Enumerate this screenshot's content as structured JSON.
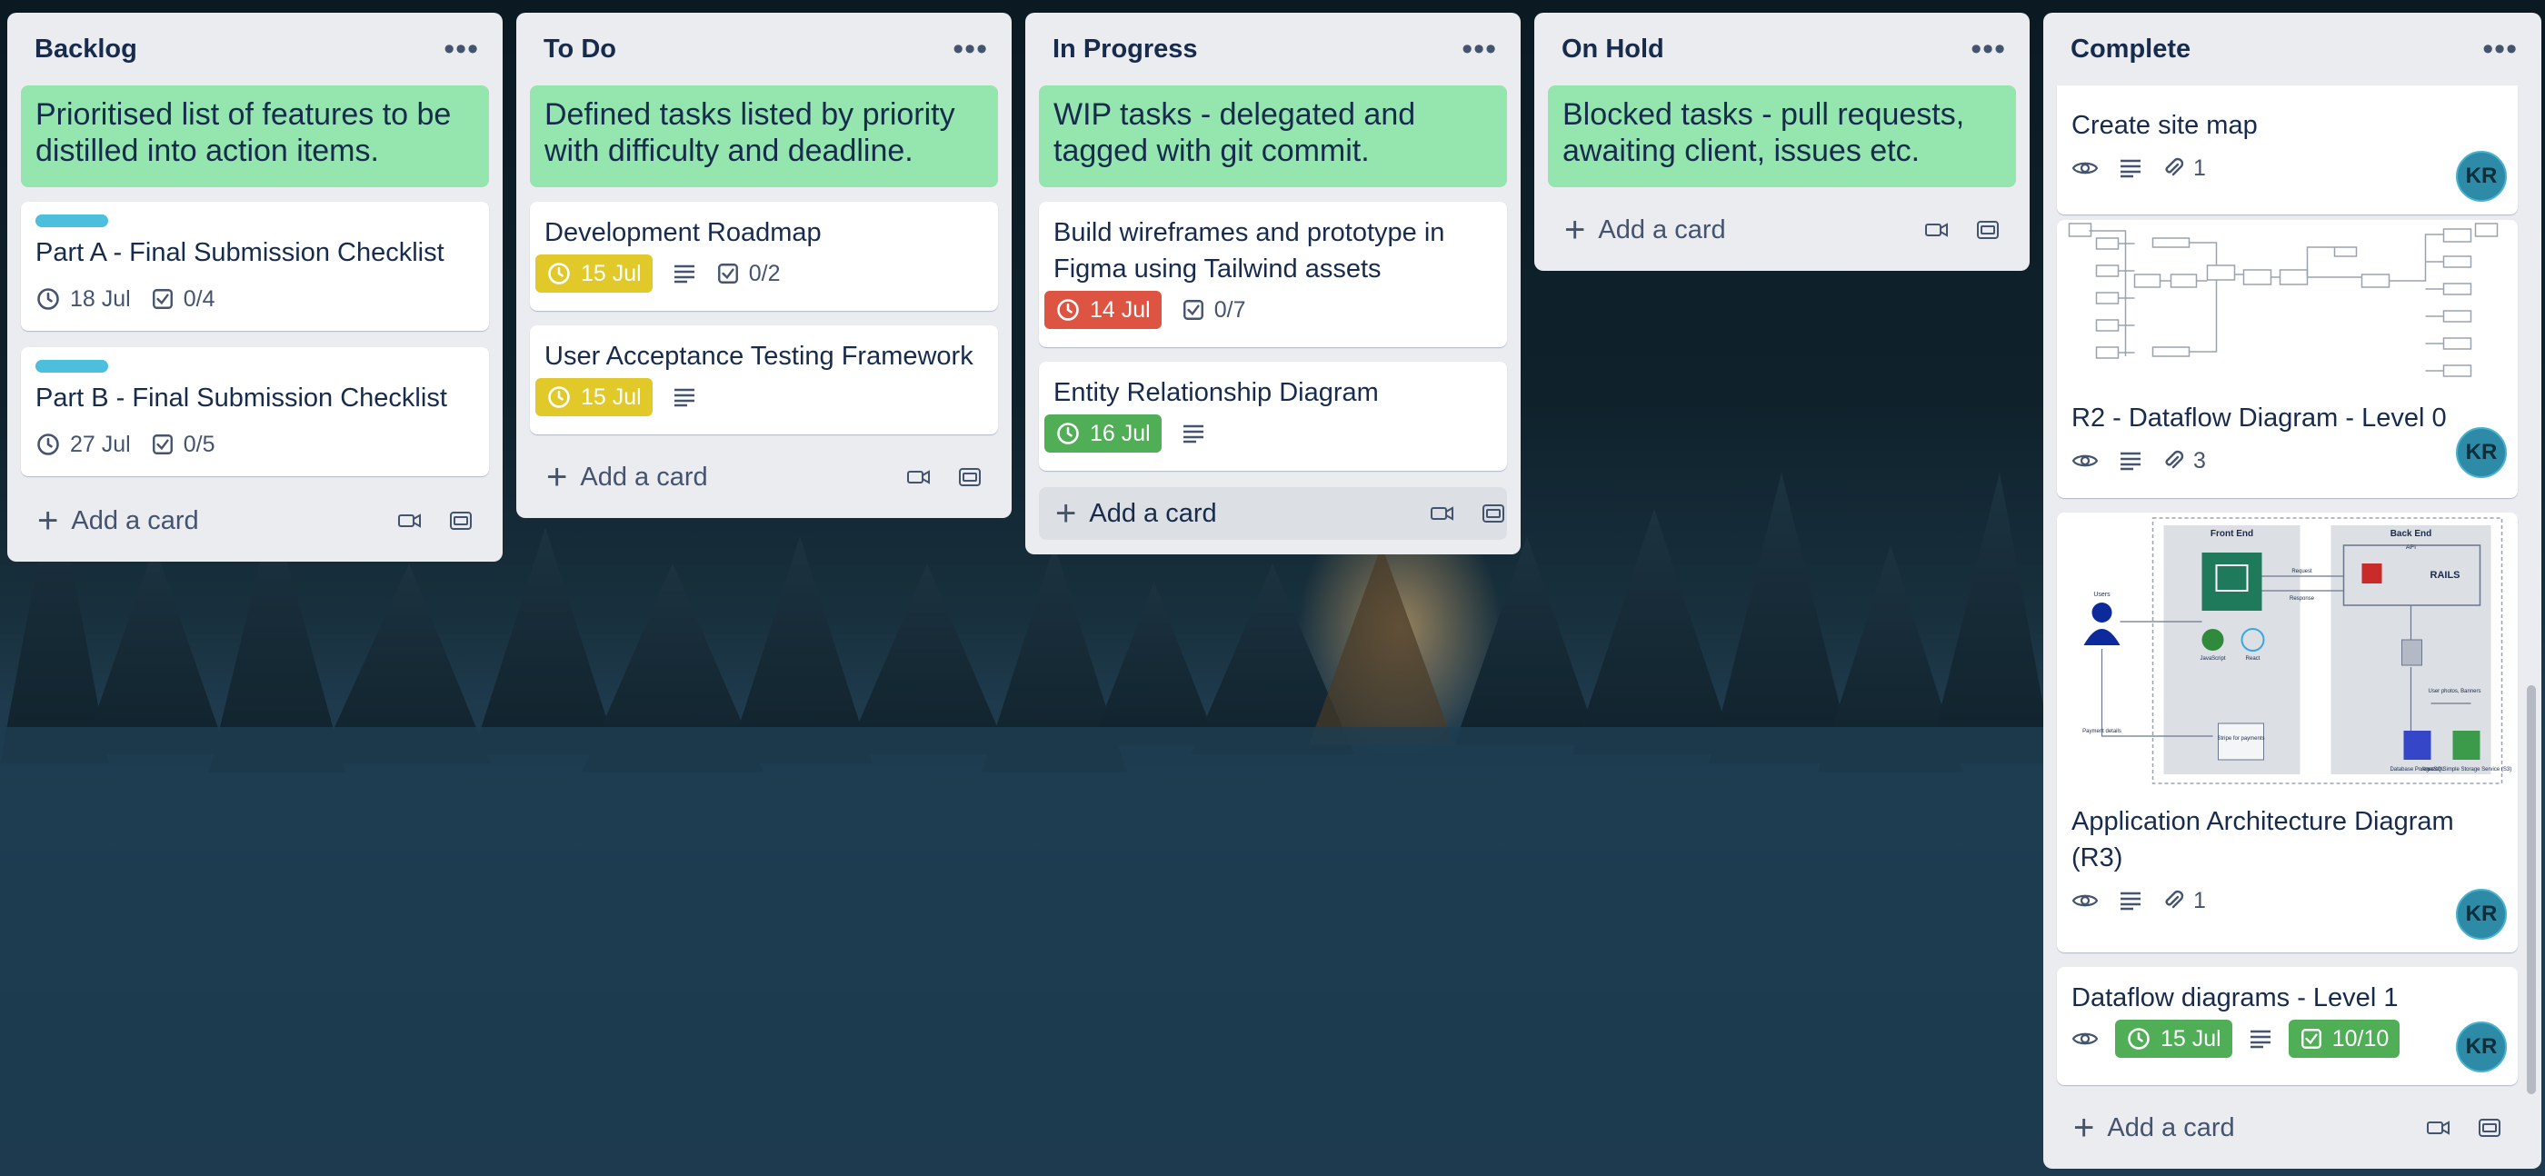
{
  "colors": {
    "list_bg": "#ebecf0",
    "green_card": "#94e5ae",
    "label_cyan": "#4bbfdb",
    "due_yellow": "#e2c92a",
    "due_red": "#dd5443",
    "due_green": "#4fae56",
    "avatar": "#2d8ba8"
  },
  "add_card_label": "Add a card",
  "lists": {
    "backlog": {
      "title": "Backlog",
      "header_card": "Prioritised list of features to be distilled into action items.",
      "cards": [
        {
          "title": "Part A - Final Submission Checklist",
          "date": "18 Jul",
          "checklist": "0/4"
        },
        {
          "title": "Part B - Final Submission Checklist",
          "date": "27 Jul",
          "checklist": "0/5"
        }
      ]
    },
    "todo": {
      "title": "To Do",
      "header_card": "Defined tasks listed by priority with difficulty and deadline.",
      "cards": [
        {
          "title": "Development Roadmap",
          "date": "15 Jul",
          "checklist": "0/2"
        },
        {
          "title": "User Acceptance Testing Framework",
          "date": "15 Jul"
        }
      ]
    },
    "inprogress": {
      "title": "In Progress",
      "header_card": "WIP tasks - delegated and tagged with git commit.",
      "cards": [
        {
          "title": "Build wireframes and prototype in Figma using Tailwind assets",
          "date": "14 Jul",
          "checklist": "0/7"
        },
        {
          "title": "Entity Relationship Diagram",
          "date": "16 Jul"
        }
      ]
    },
    "onhold": {
      "title": "On Hold",
      "header_card": "Blocked tasks - pull requests, awaiting client, issues etc."
    },
    "complete": {
      "title": "Complete",
      "cards": [
        {
          "title": "Create site map",
          "attachments": "1",
          "avatar": "KR"
        },
        {
          "title": "R2 - Dataflow Diagram - Level 0",
          "attachments": "3",
          "avatar": "KR"
        },
        {
          "title": "Application Architecture Diagram (R3)",
          "attachments": "1",
          "avatar": "KR"
        },
        {
          "title": "Dataflow diagrams - Level 1",
          "date": "15 Jul",
          "checklist": "10/10",
          "avatar": "KR"
        }
      ],
      "architecture_diagram": {
        "front_end": "Front End",
        "back_end": "Back End",
        "users": "Users",
        "api": "API",
        "rails": "RAILS",
        "react": "React",
        "javascript": "JavaScript",
        "request": "Request",
        "response": "Response",
        "payment_details": "Payment details",
        "stripe": "Stripe for payments",
        "database": "Database PostgreSQL",
        "s3": "Amazon Simple Storage Service (S3)",
        "user_photos": "User photos, Banners"
      }
    }
  }
}
